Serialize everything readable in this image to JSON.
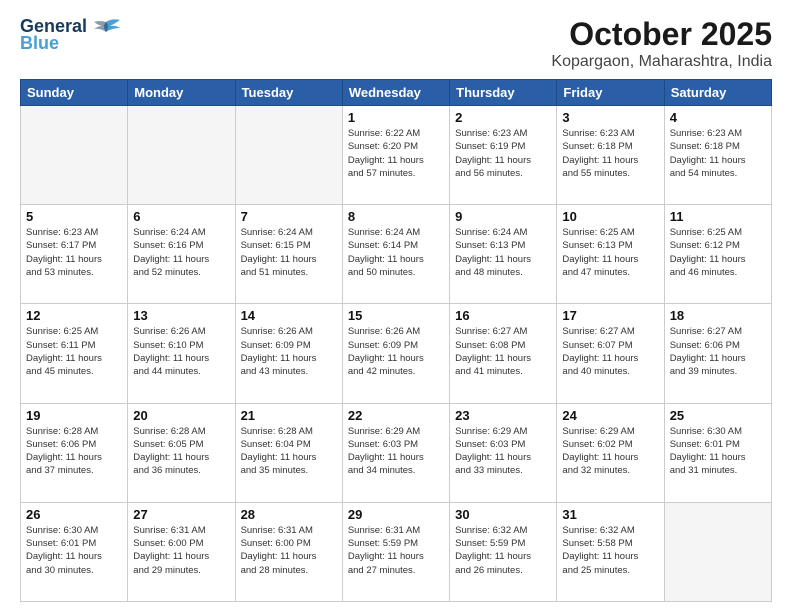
{
  "header": {
    "logo_line1": "General",
    "logo_line2": "Blue",
    "title": "October 2025",
    "subtitle": "Kopargaon, Maharashtra, India"
  },
  "weekdays": [
    "Sunday",
    "Monday",
    "Tuesday",
    "Wednesday",
    "Thursday",
    "Friday",
    "Saturday"
  ],
  "weeks": [
    [
      {
        "day": "",
        "info": ""
      },
      {
        "day": "",
        "info": ""
      },
      {
        "day": "",
        "info": ""
      },
      {
        "day": "1",
        "info": "Sunrise: 6:22 AM\nSunset: 6:20 PM\nDaylight: 11 hours\nand 57 minutes."
      },
      {
        "day": "2",
        "info": "Sunrise: 6:23 AM\nSunset: 6:19 PM\nDaylight: 11 hours\nand 56 minutes."
      },
      {
        "day": "3",
        "info": "Sunrise: 6:23 AM\nSunset: 6:18 PM\nDaylight: 11 hours\nand 55 minutes."
      },
      {
        "day": "4",
        "info": "Sunrise: 6:23 AM\nSunset: 6:18 PM\nDaylight: 11 hours\nand 54 minutes."
      }
    ],
    [
      {
        "day": "5",
        "info": "Sunrise: 6:23 AM\nSunset: 6:17 PM\nDaylight: 11 hours\nand 53 minutes."
      },
      {
        "day": "6",
        "info": "Sunrise: 6:24 AM\nSunset: 6:16 PM\nDaylight: 11 hours\nand 52 minutes."
      },
      {
        "day": "7",
        "info": "Sunrise: 6:24 AM\nSunset: 6:15 PM\nDaylight: 11 hours\nand 51 minutes."
      },
      {
        "day": "8",
        "info": "Sunrise: 6:24 AM\nSunset: 6:14 PM\nDaylight: 11 hours\nand 50 minutes."
      },
      {
        "day": "9",
        "info": "Sunrise: 6:24 AM\nSunset: 6:13 PM\nDaylight: 11 hours\nand 48 minutes."
      },
      {
        "day": "10",
        "info": "Sunrise: 6:25 AM\nSunset: 6:13 PM\nDaylight: 11 hours\nand 47 minutes."
      },
      {
        "day": "11",
        "info": "Sunrise: 6:25 AM\nSunset: 6:12 PM\nDaylight: 11 hours\nand 46 minutes."
      }
    ],
    [
      {
        "day": "12",
        "info": "Sunrise: 6:25 AM\nSunset: 6:11 PM\nDaylight: 11 hours\nand 45 minutes."
      },
      {
        "day": "13",
        "info": "Sunrise: 6:26 AM\nSunset: 6:10 PM\nDaylight: 11 hours\nand 44 minutes."
      },
      {
        "day": "14",
        "info": "Sunrise: 6:26 AM\nSunset: 6:09 PM\nDaylight: 11 hours\nand 43 minutes."
      },
      {
        "day": "15",
        "info": "Sunrise: 6:26 AM\nSunset: 6:09 PM\nDaylight: 11 hours\nand 42 minutes."
      },
      {
        "day": "16",
        "info": "Sunrise: 6:27 AM\nSunset: 6:08 PM\nDaylight: 11 hours\nand 41 minutes."
      },
      {
        "day": "17",
        "info": "Sunrise: 6:27 AM\nSunset: 6:07 PM\nDaylight: 11 hours\nand 40 minutes."
      },
      {
        "day": "18",
        "info": "Sunrise: 6:27 AM\nSunset: 6:06 PM\nDaylight: 11 hours\nand 39 minutes."
      }
    ],
    [
      {
        "day": "19",
        "info": "Sunrise: 6:28 AM\nSunset: 6:06 PM\nDaylight: 11 hours\nand 37 minutes."
      },
      {
        "day": "20",
        "info": "Sunrise: 6:28 AM\nSunset: 6:05 PM\nDaylight: 11 hours\nand 36 minutes."
      },
      {
        "day": "21",
        "info": "Sunrise: 6:28 AM\nSunset: 6:04 PM\nDaylight: 11 hours\nand 35 minutes."
      },
      {
        "day": "22",
        "info": "Sunrise: 6:29 AM\nSunset: 6:03 PM\nDaylight: 11 hours\nand 34 minutes."
      },
      {
        "day": "23",
        "info": "Sunrise: 6:29 AM\nSunset: 6:03 PM\nDaylight: 11 hours\nand 33 minutes."
      },
      {
        "day": "24",
        "info": "Sunrise: 6:29 AM\nSunset: 6:02 PM\nDaylight: 11 hours\nand 32 minutes."
      },
      {
        "day": "25",
        "info": "Sunrise: 6:30 AM\nSunset: 6:01 PM\nDaylight: 11 hours\nand 31 minutes."
      }
    ],
    [
      {
        "day": "26",
        "info": "Sunrise: 6:30 AM\nSunset: 6:01 PM\nDaylight: 11 hours\nand 30 minutes."
      },
      {
        "day": "27",
        "info": "Sunrise: 6:31 AM\nSunset: 6:00 PM\nDaylight: 11 hours\nand 29 minutes."
      },
      {
        "day": "28",
        "info": "Sunrise: 6:31 AM\nSunset: 6:00 PM\nDaylight: 11 hours\nand 28 minutes."
      },
      {
        "day": "29",
        "info": "Sunrise: 6:31 AM\nSunset: 5:59 PM\nDaylight: 11 hours\nand 27 minutes."
      },
      {
        "day": "30",
        "info": "Sunrise: 6:32 AM\nSunset: 5:59 PM\nDaylight: 11 hours\nand 26 minutes."
      },
      {
        "day": "31",
        "info": "Sunrise: 6:32 AM\nSunset: 5:58 PM\nDaylight: 11 hours\nand 25 minutes."
      },
      {
        "day": "",
        "info": ""
      }
    ]
  ]
}
